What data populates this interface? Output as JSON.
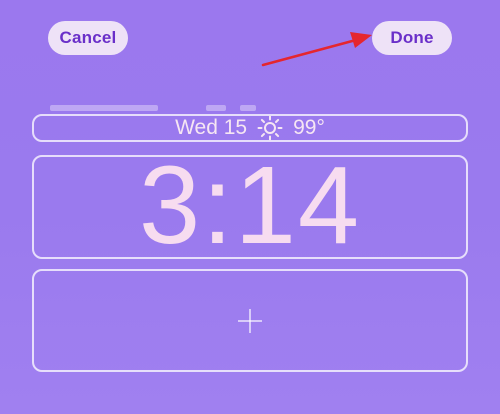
{
  "header": {
    "cancel_label": "Cancel",
    "done_label": "Done"
  },
  "lockscreen": {
    "date_label": "Wed 15",
    "weather_icon": "sun-icon",
    "temperature": "99°",
    "time": "3:14"
  },
  "widget_slot": {
    "add_icon": "plus-icon"
  },
  "colors": {
    "background": "#9b78ee",
    "button_bg": "#eee2f7",
    "button_text": "#6a2fc9",
    "annotation_arrow": "#e5262e"
  }
}
